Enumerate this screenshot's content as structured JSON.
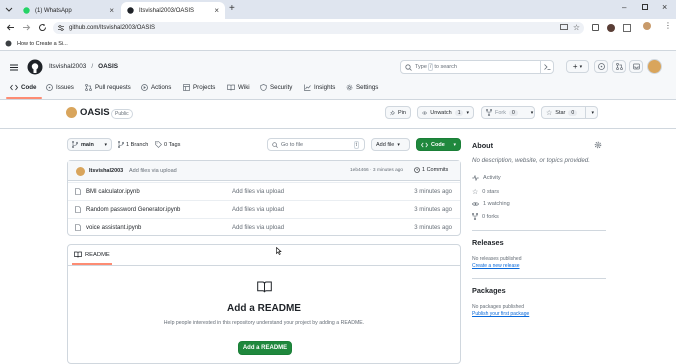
{
  "browser": {
    "tabs": [
      {
        "title": "(1) WhatsApp"
      },
      {
        "title": "Itsvishal2003/OASIS"
      }
    ],
    "url": "github.com/Itsvishal2003/OASIS",
    "bookmark": "How to Create a Si..."
  },
  "header": {
    "owner": "Itsvishal2003",
    "slash": "/",
    "repo": "OASIS",
    "search_prefix": "Type",
    "search_key": "/",
    "search_suffix": "to search"
  },
  "nav": [
    {
      "label": "Code"
    },
    {
      "label": "Issues"
    },
    {
      "label": "Pull requests"
    },
    {
      "label": "Actions"
    },
    {
      "label": "Projects"
    },
    {
      "label": "Wiki"
    },
    {
      "label": "Security"
    },
    {
      "label": "Insights"
    },
    {
      "label": "Settings"
    }
  ],
  "repo": {
    "name": "OASIS",
    "visibility": "Public",
    "pin": "Pin",
    "watch": "Unwatch",
    "watch_count": "1",
    "fork": "Fork",
    "fork_count": "0",
    "star": "Star",
    "star_count": "0"
  },
  "toolbar": {
    "branch": "main",
    "branches": "1 Branch",
    "tags": "0 Tags",
    "goto_placeholder": "Go to file",
    "goto_key": "t",
    "add_file": "Add file",
    "code": "Code"
  },
  "commit": {
    "author": "Itsvishal2003",
    "message": "Add files via upload",
    "hash_time": "1eb4466 · 3 minutes ago",
    "count": "1 Commits"
  },
  "files": [
    {
      "name": "BMI calculator.ipynb",
      "message": "Add files via upload",
      "time": "3 minutes ago"
    },
    {
      "name": "Random password Generator.ipynb",
      "message": "Add files via upload",
      "time": "3 minutes ago"
    },
    {
      "name": "voice assistant.ipynb",
      "message": "Add files via upload",
      "time": "3 minutes ago"
    }
  ],
  "readme": {
    "tab": "README",
    "title": "Add a README",
    "desc": "Help people interested in this repository understand your project by adding a README.",
    "button": "Add a README"
  },
  "about": {
    "title": "About",
    "desc": "No description, website, or topics provided.",
    "activity": "Activity",
    "stars": "0 stars",
    "watching": "1 watching",
    "forks": "0 forks"
  },
  "releases": {
    "title": "Releases",
    "none": "No releases published",
    "create": "Create a new release"
  },
  "packages": {
    "title": "Packages",
    "none": "No packages published",
    "publish": "Publish your first package"
  },
  "colors": {
    "accent": "#0969da",
    "green": "#1f883d",
    "underline": "#fd8c73"
  }
}
